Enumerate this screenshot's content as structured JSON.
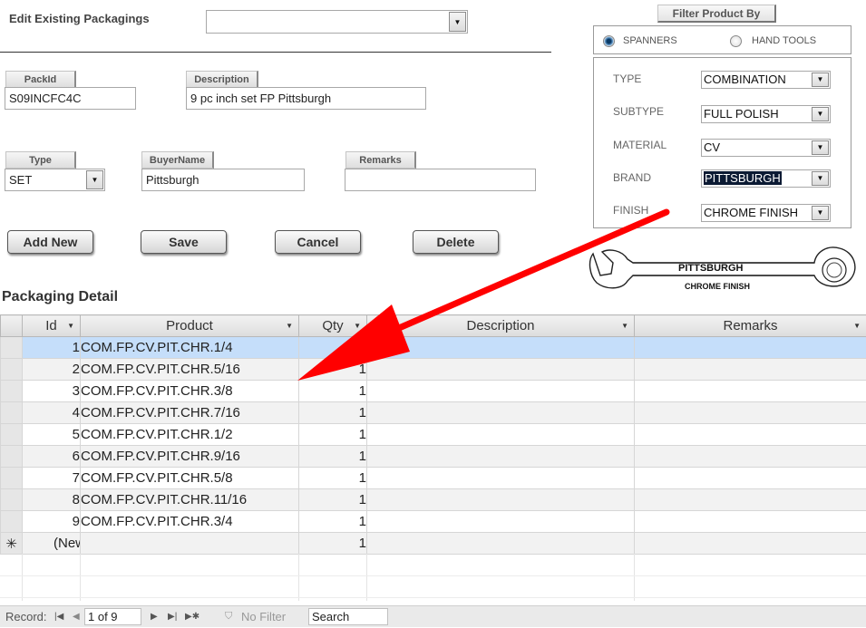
{
  "header": {
    "title": "Edit Existing Packagings",
    "packaging_select_value": ""
  },
  "fields": {
    "packid": {
      "label": "PackId",
      "value": "S09INCFC4C"
    },
    "description": {
      "label": "Description",
      "value": "9 pc inch set FP Pittsburgh"
    },
    "type": {
      "label": "Type",
      "value": "SET"
    },
    "buyername": {
      "label": "BuyerName",
      "value": "Pittsburgh"
    },
    "remarks": {
      "label": "Remarks",
      "value": ""
    }
  },
  "buttons": {
    "add_new": "Add New",
    "save": "Save",
    "cancel": "Cancel",
    "delete": "Delete"
  },
  "filter": {
    "title": "Filter Product By",
    "radio_spanners": "SPANNERS",
    "radio_hand_tools": "HAND TOOLS",
    "selected_radio": "SPANNERS",
    "type_label": "TYPE",
    "type_value": "COMBINATION",
    "subtype_label": "SUBTYPE",
    "subtype_value": "FULL POLISH",
    "material_label": "MATERIAL",
    "material_value": "CV",
    "brand_label": "BRAND",
    "brand_value": "PITTSBURGH",
    "finish_label": "FINISH",
    "finish_value": "CHROME FINISH"
  },
  "preview": {
    "brand_text": "PITTSBURGH",
    "finish_text": "CHROME FINISH"
  },
  "detail": {
    "section_title": "Packaging Detail",
    "columns": [
      "Id",
      "Product",
      "Qty",
      "Description",
      "Remarks"
    ],
    "rows": [
      {
        "id": "1",
        "product": "COM.FP.CV.PIT.CHR.1/4",
        "qty": "1",
        "description": "",
        "remarks": ""
      },
      {
        "id": "2",
        "product": "COM.FP.CV.PIT.CHR.5/16",
        "qty": "1",
        "description": "",
        "remarks": ""
      },
      {
        "id": "3",
        "product": "COM.FP.CV.PIT.CHR.3/8",
        "qty": "1",
        "description": "",
        "remarks": ""
      },
      {
        "id": "4",
        "product": "COM.FP.CV.PIT.CHR.7/16",
        "qty": "1",
        "description": "",
        "remarks": ""
      },
      {
        "id": "5",
        "product": "COM.FP.CV.PIT.CHR.1/2",
        "qty": "1",
        "description": "",
        "remarks": ""
      },
      {
        "id": "6",
        "product": "COM.FP.CV.PIT.CHR.9/16",
        "qty": "1",
        "description": "",
        "remarks": ""
      },
      {
        "id": "7",
        "product": "COM.FP.CV.PIT.CHR.5/8",
        "qty": "1",
        "description": "",
        "remarks": ""
      },
      {
        "id": "8",
        "product": "COM.FP.CV.PIT.CHR.11/16",
        "qty": "1",
        "description": "",
        "remarks": ""
      },
      {
        "id": "9",
        "product": "COM.FP.CV.PIT.CHR.3/4",
        "qty": "1",
        "description": "",
        "remarks": ""
      }
    ],
    "new_row": {
      "id": "(New)",
      "qty": "1"
    }
  },
  "navigation": {
    "record_label": "Record:",
    "record_value": "1 of 9",
    "no_filter": "No Filter",
    "search_placeholder": "Search"
  },
  "colors": {
    "arrow": "#ff0000",
    "current_row": "#c5defa",
    "brand_highlight": "#0b1a33"
  },
  "icons": {
    "first_record": "first-record-icon",
    "prev_record": "previous-record-icon",
    "next_record": "next-record-icon",
    "last_record": "last-record-icon",
    "new_record": "new-record-icon",
    "filter": "funnel-filter-icon",
    "new_row_marker": "asterisk-icon"
  }
}
